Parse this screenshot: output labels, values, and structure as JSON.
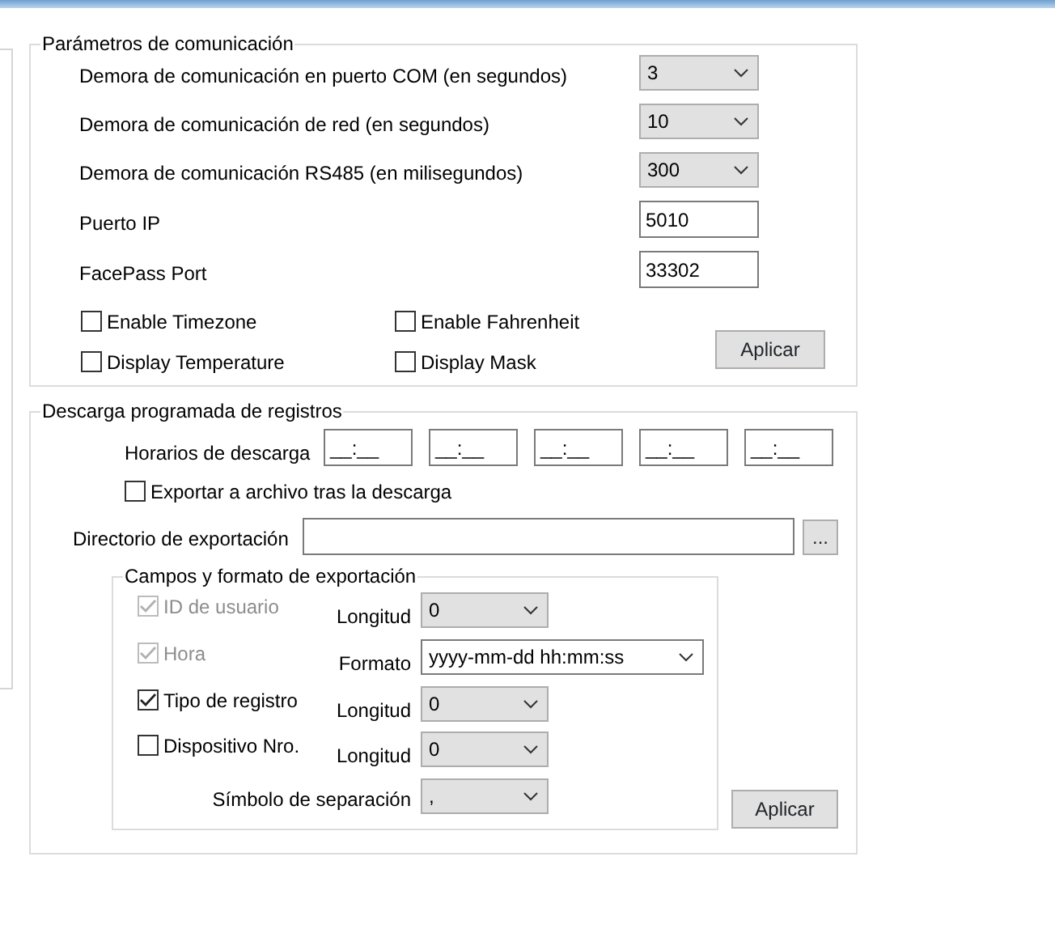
{
  "communication": {
    "title": "Parámetros de comunicación",
    "fields": [
      {
        "kind": "select",
        "label": "Demora de comunicación en puerto COM (en segundos)",
        "value": "3"
      },
      {
        "kind": "select",
        "label": "Demora de comunicación de red (en segundos)",
        "value": "10"
      },
      {
        "kind": "select",
        "label": "Demora de comunicación RS485 (en milisegundos)",
        "value": "300"
      },
      {
        "kind": "input",
        "label": "Puerto IP",
        "value": "5010"
      },
      {
        "kind": "input",
        "label": "FacePass Port",
        "value": "33302"
      }
    ],
    "checkboxes": [
      {
        "label": "Enable Timezone",
        "checked": false
      },
      {
        "label": "Enable Fahrenheit",
        "checked": false
      },
      {
        "label": "Display Temperature",
        "checked": false
      },
      {
        "label": "Display Mask",
        "checked": false
      }
    ],
    "apply_button": "Aplicar"
  },
  "download": {
    "title": "Descarga programada de registros",
    "schedule_label": "Horarios de descarga",
    "times": [
      "__:__",
      "__:__",
      "__:__",
      "__:__",
      "__:__"
    ],
    "export_after": {
      "label": "Exportar a archivo tras la descarga",
      "checked": false
    },
    "directory_label": "Directorio de exportación",
    "browse_button": "...",
    "fields_group": {
      "title": "Campos y formato de exportación",
      "rows": [
        {
          "kind": "short",
          "label": "ID de usuario",
          "checked": true,
          "disabled": true,
          "option_label": "Longitud",
          "value": "0"
        },
        {
          "kind": "wide",
          "label": "Hora",
          "checked": true,
          "disabled": true,
          "option_label": "Formato",
          "value": "yyyy-mm-dd hh:mm:ss"
        },
        {
          "kind": "short",
          "label": "Tipo de registro",
          "checked": true,
          "disabled": false,
          "option_label": "Longitud",
          "value": "0"
        },
        {
          "kind": "short",
          "label": "Dispositivo Nro.",
          "checked": false,
          "disabled": false,
          "option_label": "Longitud",
          "value": "0"
        }
      ],
      "separator": {
        "label": "Símbolo de separación",
        "value": ","
      }
    },
    "apply_button": "Aplicar"
  }
}
